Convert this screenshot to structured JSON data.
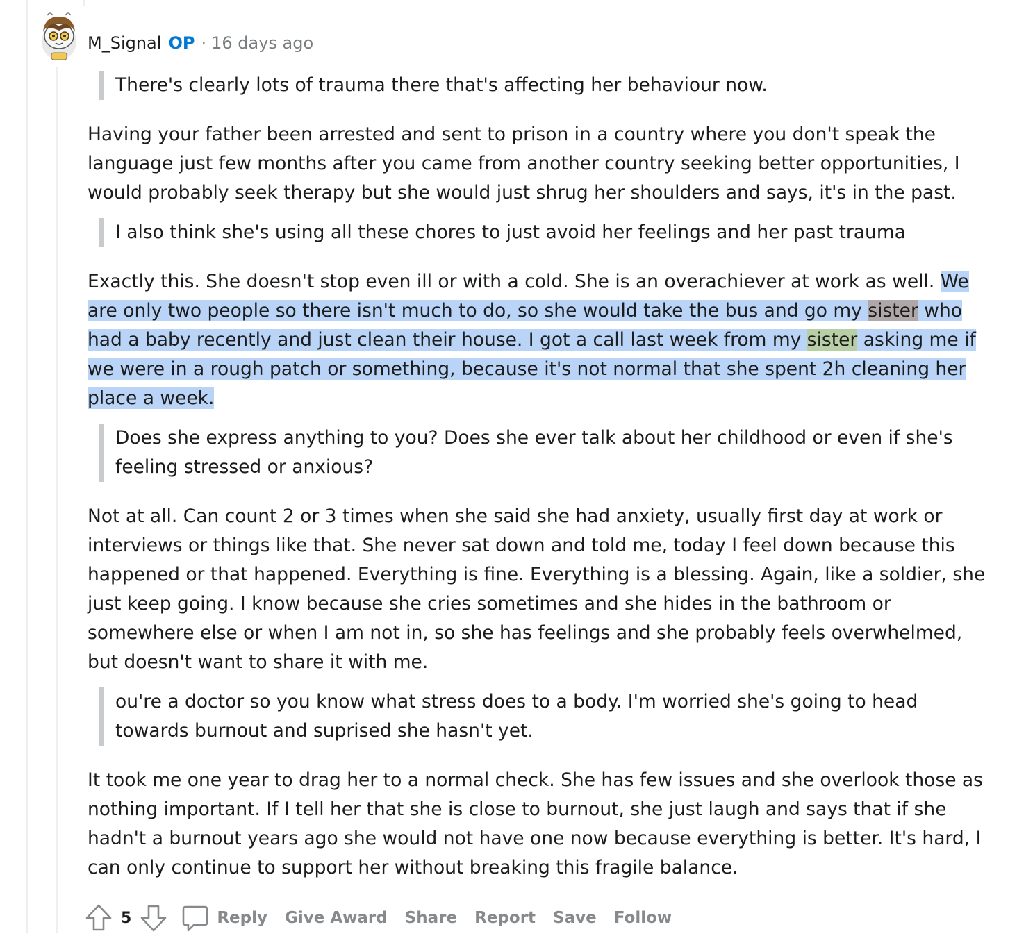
{
  "comment": {
    "author": "M_Signal",
    "op_badge": "OP",
    "separator": "·",
    "time_ago": "16 days ago",
    "blocks": {
      "q1": "There's clearly lots of trauma there that's affecting her behaviour now.",
      "p1": [
        "Having your father been arrested and sent to prison in a country where you don't speak the",
        "language just few months after you came from another country seeking better opportunities, I",
        "would probably seek therapy but she would just shrug her shoulders and says, it's in the past."
      ],
      "q2": "I also think she's using all these chores to just avoid her feelings and her past trauma",
      "p2": {
        "l1a": "Exactly this. She doesn't stop even ill or with a cold. She is an overachiever at work as well. ",
        "l1b": "We",
        "l2a": "are only two people so there isn't much to do, so she would take the bus and go my ",
        "l2b": "sister",
        "l2c": " who",
        "l3a": "had a baby recently and just clean their house. I got a call last week from my ",
        "l3b": "sister",
        "l3c": " asking me if",
        "l4": "we were in a rough patch or something, because it's not normal that she spent 2h cleaning her",
        "l5": "place a week."
      },
      "q3": [
        "Does she express anything to you? Does she ever talk about her childhood or even if she's",
        "feeling stressed or anxious?"
      ],
      "p3": [
        "Not at all. Can count 2 or 3 times when she said she had anxiety, usually first day at work or",
        "interviews or things like that. She never sat down and told me, today I feel down because this",
        "happened or that happened. Everything is fine. Everything is a blessing. Again, like a soldier, she",
        "just keep going. I know because she cries sometimes and she hides in the bathroom or",
        "somewhere else or when I am not in, so she has feelings and she probably feels overwhelmed,",
        "but doesn't want to share it with me."
      ],
      "q4": [
        "ou're a doctor so you know what stress does to a body. I'm worried she's going to head",
        "towards burnout and suprised she hasn't yet."
      ],
      "p4": [
        "It took me one year to drag her to a normal check. She has few issues and she overlook those as",
        "nothing important. If I tell her that she is close to burnout, she just laugh and says that if she",
        "hadn't a burnout years ago she would not have one now because everything is better. It's hard, I",
        "can only continue to support her without breaking this fragile balance."
      ]
    },
    "actions": {
      "score": "5",
      "reply": "Reply",
      "give_award": "Give Award",
      "share": "Share",
      "report": "Report",
      "save": "Save",
      "follow": "Follow"
    }
  },
  "colors": {
    "op_blue": "#0079d3",
    "selection": "#b9d4f6",
    "highlight_dark": "#b0a8a8",
    "highlight_green": "#b8cfa6",
    "muted": "#878a8c",
    "thread_line": "#edeff1"
  },
  "icons": [
    "avatar-icon",
    "upvote-icon",
    "downvote-icon",
    "comment-icon"
  ]
}
